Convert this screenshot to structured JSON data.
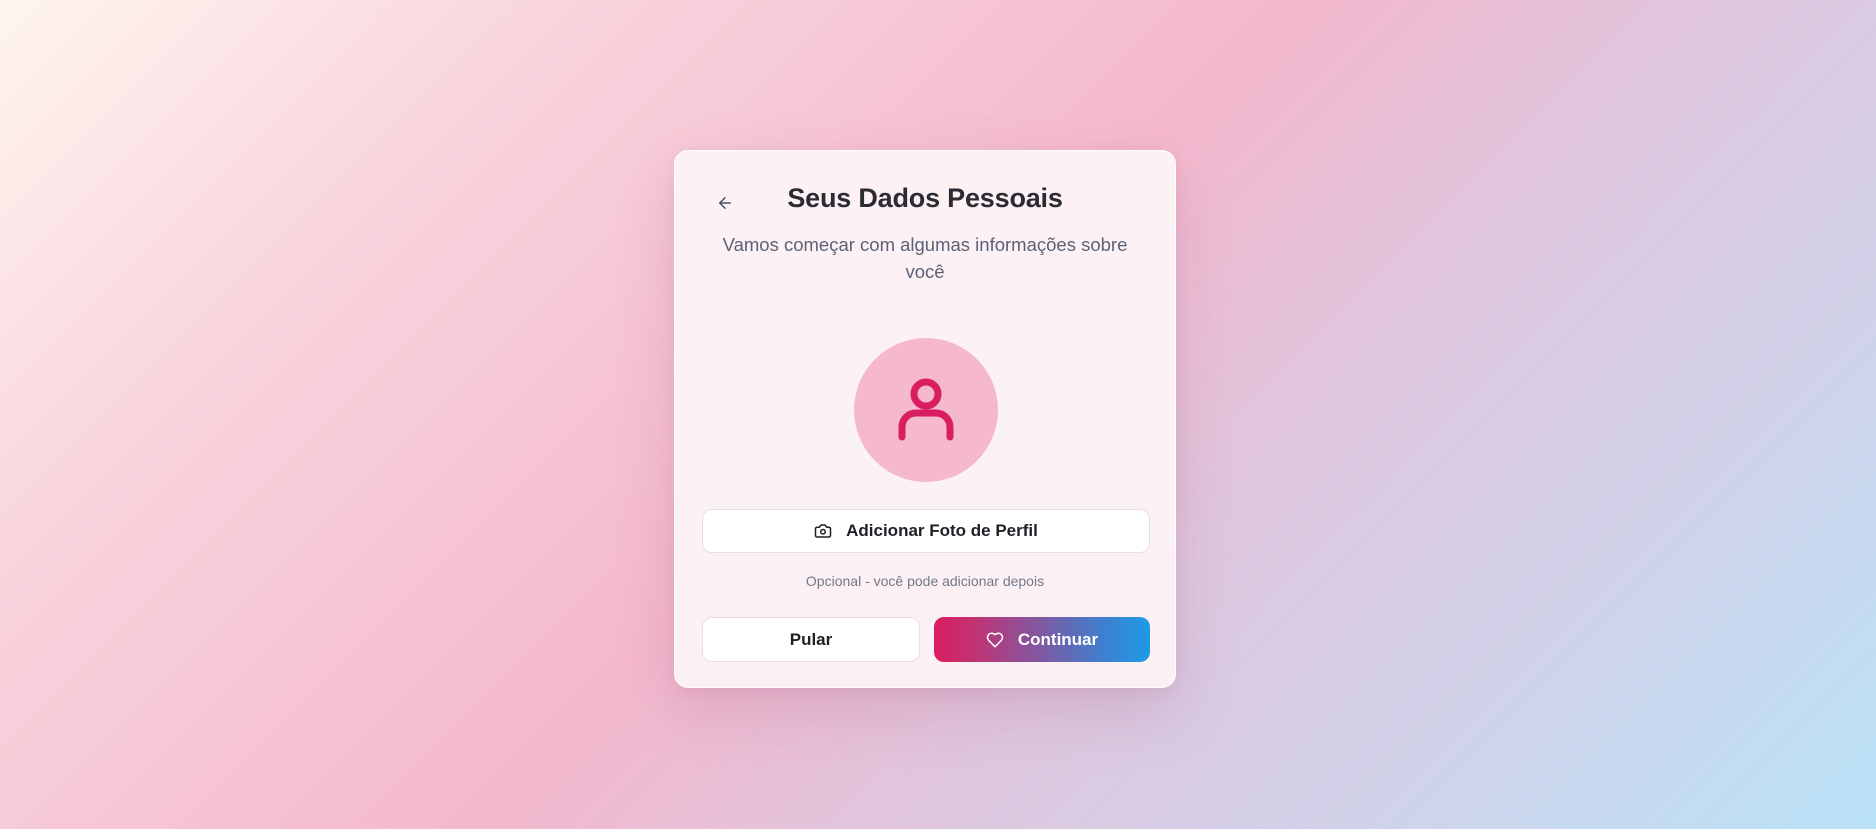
{
  "header": {
    "title": "Seus Dados Pessoais",
    "subtitle": "Vamos começar com algumas informações sobre você",
    "back_icon": "arrow-left-icon"
  },
  "avatar": {
    "icon": "user-icon",
    "background_color": "#f5b8cd",
    "icon_color": "#d81e60"
  },
  "photo_button": {
    "label": "Adicionar Foto de Perfil",
    "icon": "camera-icon"
  },
  "hint": {
    "text": "Opcional - você pode adicionar depois"
  },
  "actions": {
    "skip_label": "Pular",
    "continue_label": "Continuar",
    "continue_icon": "heart-icon",
    "gradient_start": "#d81e60",
    "gradient_end": "#1e9be6"
  }
}
